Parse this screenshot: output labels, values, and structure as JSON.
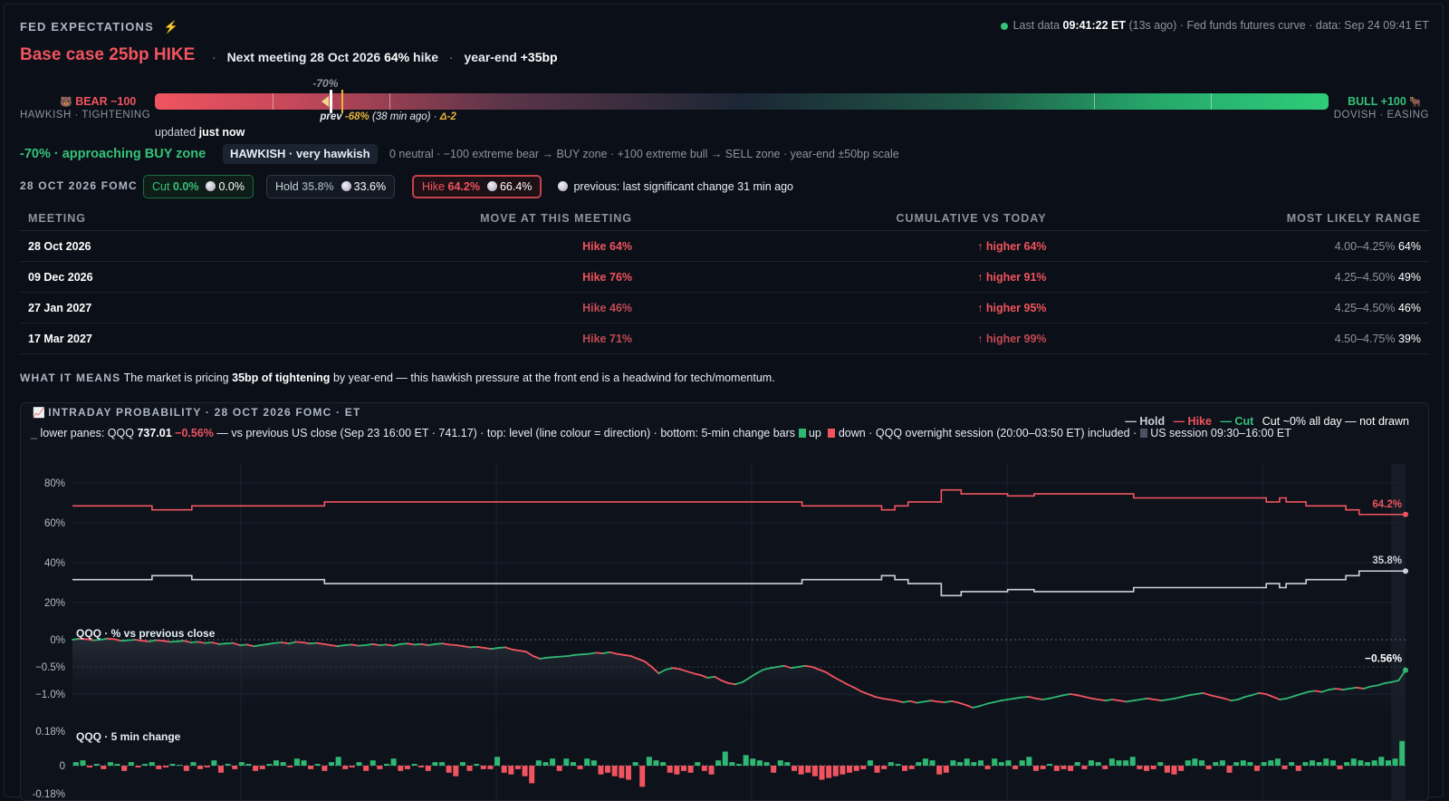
{
  "header": {
    "title": "FED EXPECTATIONS",
    "title_icon": "lightning-icon",
    "status_prefix": "Last data",
    "status_time": "09:41:22 ET",
    "status_ago": "(13s ago)",
    "status_sep": "·",
    "status_source": "Fed funds futures curve",
    "status_data": "data: Sep 24 09:41 ET"
  },
  "headline": {
    "base_case": "Base case 25bp HIKE",
    "sep": "·",
    "next_prefix": "Next meeting 28 Oct 2026",
    "next_pct": "64%",
    "next_suffix": "hike",
    "ye_prefix": "year-end",
    "ye_value": "+35bp"
  },
  "gauge": {
    "bear_label": "BEAR −100",
    "bear_sub": "HAWKISH · TIGHTENING",
    "bull_label": "BULL +100",
    "bull_sub": "DOVISH · EASING",
    "current_label": "-70%",
    "current_value": -70,
    "prev_label": "prev",
    "prev_value_label": "-68%",
    "prev_value": -68,
    "prev_ago": "(38 min ago)",
    "delta": "Δ-2",
    "updated_prefix": "updated",
    "updated_value": "just now"
  },
  "zone": {
    "value": "-70% · approaching BUY zone",
    "badge": "HAWKISH · very hawkish",
    "scale_note": "0 neutral · −100 extreme bear → BUY zone · +100 extreme bull → SELL zone · year-end ±50bp scale"
  },
  "fomc": {
    "label": "28 OCT 2026 FOMC",
    "pills": [
      {
        "name": "Cut",
        "pct": "0.0%",
        "prev": "0.0%",
        "color": "#35c27a"
      },
      {
        "name": "Hold",
        "pct": "35.8%",
        "prev": "33.6%",
        "color": "#8b949e"
      },
      {
        "name": "Hike",
        "pct": "64.2%",
        "prev": "66.4%",
        "color": "#f0545f"
      }
    ],
    "previous_note": "previous: last significant change 31 min ago"
  },
  "table": {
    "headers": [
      "MEETING",
      "MOVE AT THIS MEETING",
      "CUMULATIVE VS TODAY",
      "MOST LIKELY RANGE"
    ],
    "rows": [
      {
        "meeting": "28 Oct 2026",
        "move": "Hike 64%",
        "cum": "↑ higher 64%",
        "range": "4.00–4.25%",
        "range_pct": "64%"
      },
      {
        "meeting": "09 Dec 2026",
        "move": "Hike 76%",
        "cum": "↑ higher 91%",
        "range": "4.25–4.50%",
        "range_pct": "49%"
      },
      {
        "meeting": "27 Jan 2027",
        "move": "Hike 46%",
        "cum": "↑ higher 95%",
        "range": "4.25–4.50%",
        "range_pct": "46%"
      },
      {
        "meeting": "17 Mar 2027",
        "move": "Hike 71%",
        "cum": "↑ higher 99%",
        "range": "4.50–4.75%",
        "range_pct": "39%"
      }
    ]
  },
  "meaning": {
    "label": "WHAT IT MEANS",
    "text1": "The market is pricing",
    "bold": "35bp of tightening",
    "text2": "by year-end — this hawkish pressure at the front end is a headwind for tech/momentum."
  },
  "intraday": {
    "title": "INTRADAY PROBABILITY · 28 OCT 2026 FOMC · ET",
    "title_icon": "chart-icon",
    "legend_hold": "— Hold",
    "legend_hike": "— Hike",
    "legend_cut": "— Cut",
    "legend_note": "Cut ~0% all day — not drawn",
    "sub_prefix": "lower panes: QQQ",
    "qqq_price": "737.01",
    "qqq_change": "−0.56%",
    "sub_mid": "— vs previous US close (Sep 23 16:00 ET · 741.17) · top: level (line colour = direction) · bottom: 5-min change bars",
    "up_label": "up",
    "down_label": "down",
    "sub_tail": "· QQQ overnight session (20:00–03:50 ET) included ·",
    "us_session": "US session 09:30–16:00 ET",
    "pane2_label": "QQQ · % vs previous close",
    "pane3_label": "QQQ · 5 min change"
  },
  "chart_data": [
    {
      "type": "line",
      "title": "INTRADAY PROBABILITY · 28 OCT 2026 FOMC · ET",
      "ylim": [
        10,
        85
      ],
      "yticks": [
        "80%",
        "60%",
        "40%",
        "20%"
      ],
      "series": [
        {
          "name": "Hike",
          "color": "#f0545f",
          "end_label": "64.2%",
          "values": [
            68.5,
            68.5,
            68.5,
            68.5,
            68.5,
            68.5,
            68.5,
            68.5,
            68.5,
            68.5,
            68.5,
            68.5,
            66.5,
            66.5,
            66.5,
            66.5,
            66.5,
            66.5,
            68.5,
            68.5,
            68.5,
            68.5,
            68.5,
            68.5,
            68.5,
            68.5,
            68.5,
            68.5,
            68.5,
            68.5,
            68.5,
            68.5,
            68.5,
            68.5,
            68.5,
            68.5,
            68.5,
            68.5,
            70.5,
            70.5,
            70.5,
            70.5,
            70.5,
            70.5,
            70.5,
            70.5,
            70.5,
            70.5,
            70.5,
            70.5,
            70.5,
            70.5,
            70.5,
            70.5,
            70.5,
            70.5,
            70.5,
            70.5,
            70.5,
            70.5,
            70.5,
            70.5,
            70.5,
            70.5,
            70.5,
            70.5,
            70.5,
            70.5,
            70.5,
            70.5,
            70.5,
            70.5,
            70.5,
            70.5,
            70.5,
            70.5,
            70.5,
            70.5,
            70.5,
            70.5,
            70.5,
            70.5,
            70.5,
            70.5,
            70.5,
            70.5,
            70.5,
            70.5,
            70.5,
            70.5,
            70.5,
            70.5,
            70.5,
            70.5,
            70.5,
            70.5,
            70.5,
            70.5,
            70.5,
            70.5,
            70.5,
            70.5,
            70.5,
            70.5,
            70.5,
            70.5,
            70.5,
            70.5,
            70.5,
            70.5,
            68.5,
            68.5,
            68.5,
            68.5,
            68.5,
            68.5,
            68.5,
            68.5,
            68.5,
            68.5,
            68.5,
            68.5,
            66.5,
            66.5,
            68.5,
            68.5,
            70.5,
            70.5,
            70.5,
            70.5,
            70.5,
            76.5,
            76.5,
            76.5,
            74.5,
            74.5,
            74.5,
            74.5,
            74.5,
            74.5,
            74.5,
            73.5,
            73.5,
            73.5,
            73.5,
            74.5,
            74.5,
            74.5,
            74.5,
            74.5,
            74.5,
            74.5,
            74.5,
            74.5,
            74.5,
            74.5,
            74.5,
            74.5,
            74.5,
            74.5,
            72.5,
            72.5,
            72.5,
            72.5,
            72.5,
            72.5,
            72.5,
            72.5,
            72.5,
            72.5,
            72.5,
            72.5,
            72.5,
            72.5,
            72.5,
            72.5,
            72.5,
            72.5,
            72.5,
            72.5,
            70.5,
            70.5,
            72.5,
            70.5,
            70.5,
            70.5,
            68.5,
            68.5,
            68.5,
            68.5,
            68.5,
            68.5,
            66.5,
            66.5,
            64.2,
            64.2,
            64.2,
            64.2,
            64.2,
            64.2,
            64.2,
            64.2
          ]
        },
        {
          "name": "Hold",
          "color": "#c9d1d9",
          "end_label": "35.8%",
          "values": [
            31.5,
            31.5,
            31.5,
            31.5,
            31.5,
            31.5,
            31.5,
            31.5,
            31.5,
            31.5,
            31.5,
            31.5,
            33.5,
            33.5,
            33.5,
            33.5,
            33.5,
            33.5,
            31.5,
            31.5,
            31.5,
            31.5,
            31.5,
            31.5,
            31.5,
            31.5,
            31.5,
            31.5,
            31.5,
            31.5,
            31.5,
            31.5,
            31.5,
            31.5,
            31.5,
            31.5,
            31.5,
            31.5,
            29.5,
            29.5,
            29.5,
            29.5,
            29.5,
            29.5,
            29.5,
            29.5,
            29.5,
            29.5,
            29.5,
            29.5,
            29.5,
            29.5,
            29.5,
            29.5,
            29.5,
            29.5,
            29.5,
            29.5,
            29.5,
            29.5,
            29.5,
            29.5,
            29.5,
            29.5,
            29.5,
            29.5,
            29.5,
            29.5,
            29.5,
            29.5,
            29.5,
            29.5,
            29.5,
            29.5,
            29.5,
            29.5,
            29.5,
            29.5,
            29.5,
            29.5,
            29.5,
            29.5,
            29.5,
            29.5,
            29.5,
            29.5,
            29.5,
            29.5,
            29.5,
            29.5,
            29.5,
            29.5,
            29.5,
            29.5,
            29.5,
            29.5,
            29.5,
            29.5,
            29.5,
            29.5,
            29.5,
            29.5,
            29.5,
            29.5,
            29.5,
            29.5,
            29.5,
            29.5,
            29.5,
            29.5,
            31.5,
            31.5,
            31.5,
            31.5,
            31.5,
            31.5,
            31.5,
            31.5,
            31.5,
            31.5,
            31.5,
            31.5,
            33.5,
            33.5,
            31.5,
            31.5,
            29.5,
            29.5,
            29.5,
            29.5,
            29.5,
            23.5,
            23.5,
            23.5,
            25.5,
            25.5,
            25.5,
            25.5,
            25.5,
            25.5,
            25.5,
            26.5,
            26.5,
            26.5,
            26.5,
            25.5,
            25.5,
            25.5,
            25.5,
            25.5,
            25.5,
            25.5,
            25.5,
            25.5,
            25.5,
            25.5,
            25.5,
            25.5,
            25.5,
            25.5,
            27.5,
            27.5,
            27.5,
            27.5,
            27.5,
            27.5,
            27.5,
            27.5,
            27.5,
            27.5,
            27.5,
            27.5,
            27.5,
            27.5,
            27.5,
            27.5,
            27.5,
            27.5,
            27.5,
            27.5,
            29.5,
            29.5,
            27.5,
            29.5,
            29.5,
            29.5,
            31.5,
            31.5,
            31.5,
            31.5,
            31.5,
            31.5,
            33.5,
            33.5,
            35.8,
            35.8,
            35.8,
            35.8,
            35.8,
            35.8,
            35.8,
            35.8
          ]
        }
      ]
    },
    {
      "type": "line",
      "title": "QQQ · % vs previous close",
      "ylim": [
        -1.35,
        0.1
      ],
      "yticks": [
        "0%",
        "−0.5%",
        "−1.0%"
      ],
      "end_label": "−0.56%",
      "series": [
        {
          "name": "QQQ",
          "values": [
            0.0,
            0.02,
            0.01,
            -0.01,
            0.0,
            0.02,
            0.01,
            -0.02,
            -0.01,
            0.0,
            -0.02,
            -0.03,
            -0.01,
            -0.02,
            -0.04,
            -0.03,
            -0.02,
            -0.05,
            -0.04,
            -0.06,
            -0.05,
            -0.08,
            -0.07,
            -0.06,
            -0.1,
            -0.09,
            -0.12,
            -0.1,
            -0.08,
            -0.06,
            -0.05,
            -0.07,
            -0.04,
            -0.05,
            -0.07,
            -0.06,
            -0.08,
            -0.1,
            -0.12,
            -0.1,
            -0.09,
            -0.11,
            -0.1,
            -0.08,
            -0.1,
            -0.09,
            -0.11,
            -0.08,
            -0.07,
            -0.09,
            -0.08,
            -0.1,
            -0.08,
            -0.07,
            -0.09,
            -0.1,
            -0.12,
            -0.14,
            -0.13,
            -0.15,
            -0.17,
            -0.15,
            -0.14,
            -0.18,
            -0.2,
            -0.22,
            -0.3,
            -0.35,
            -0.33,
            -0.32,
            -0.31,
            -0.3,
            -0.28,
            -0.27,
            -0.26,
            -0.24,
            -0.25,
            -0.23,
            -0.26,
            -0.28,
            -0.3,
            -0.35,
            -0.4,
            -0.5,
            -0.62,
            -0.55,
            -0.52,
            -0.54,
            -0.58,
            -0.62,
            -0.65,
            -0.7,
            -0.68,
            -0.75,
            -0.8,
            -0.82,
            -0.78,
            -0.7,
            -0.62,
            -0.55,
            -0.52,
            -0.5,
            -0.48,
            -0.52,
            -0.5,
            -0.48,
            -0.5,
            -0.55,
            -0.6,
            -0.68,
            -0.75,
            -0.82,
            -0.88,
            -0.95,
            -1.0,
            -1.05,
            -1.08,
            -1.1,
            -1.12,
            -1.15,
            -1.13,
            -1.16,
            -1.14,
            -1.12,
            -1.14,
            -1.15,
            -1.13,
            -1.16,
            -1.2,
            -1.25,
            -1.22,
            -1.18,
            -1.15,
            -1.12,
            -1.1,
            -1.08,
            -1.06,
            -1.05,
            -1.08,
            -1.1,
            -1.08,
            -1.05,
            -1.02,
            -1.0,
            -1.02,
            -1.05,
            -1.08,
            -1.1,
            -1.12,
            -1.1,
            -1.12,
            -1.14,
            -1.12,
            -1.1,
            -1.08,
            -1.1,
            -1.12,
            -1.1,
            -1.08,
            -1.05,
            -1.02,
            -1.0,
            -0.98,
            -1.02,
            -1.05,
            -1.08,
            -1.12,
            -1.1,
            -1.05,
            -1.02,
            -0.98,
            -1.0,
            -1.05,
            -1.1,
            -1.08,
            -1.04,
            -1.0,
            -0.96,
            -0.94,
            -0.96,
            -0.92,
            -0.9,
            -0.92,
            -0.9,
            -0.88,
            -0.9,
            -0.86,
            -0.84,
            -0.8,
            -0.78,
            -0.75,
            -0.56
          ]
        }
      ]
    },
    {
      "type": "bar",
      "title": "QQQ · 5 min change",
      "ylim": [
        -0.18,
        0.18
      ],
      "yticks": [
        "0.18%",
        "0",
        "-0.18%"
      ],
      "values": [
        0.02,
        0.03,
        -0.01,
        0.01,
        -0.02,
        0.02,
        0.01,
        -0.03,
        0.02,
        -0.01,
        0.01,
        0.02,
        -0.02,
        -0.01,
        0.01,
        0.0,
        -0.03,
        0.02,
        -0.02,
        -0.01,
        0.03,
        -0.04,
        0.01,
        -0.02,
        0.02,
        0.01,
        -0.03,
        -0.02,
        0.01,
        0.03,
        0.02,
        -0.01,
        0.04,
        0.03,
        -0.02,
        0.01,
        -0.03,
        0.02,
        0.05,
        -0.02,
        -0.01,
        0.02,
        -0.03,
        0.03,
        -0.02,
        0.01,
        0.04,
        -0.03,
        -0.02,
        0.01,
        -0.01,
        -0.03,
        0.02,
        0.02,
        -0.04,
        -0.06,
        0.02,
        -0.03,
        0.01,
        -0.02,
        -0.02,
        0.05,
        -0.04,
        -0.05,
        -0.02,
        -0.06,
        -0.1,
        0.03,
        0.02,
        0.04,
        -0.03,
        0.04,
        0.02,
        -0.02,
        0.04,
        0.03,
        -0.05,
        -0.04,
        -0.06,
        -0.07,
        -0.08,
        0.02,
        -0.12,
        0.05,
        0.03,
        0.02,
        -0.04,
        -0.05,
        -0.03,
        -0.04,
        0.02,
        -0.03,
        -0.05,
        0.03,
        0.08,
        0.02,
        0.01,
        0.06,
        0.04,
        0.03,
        0.02,
        -0.04,
        0.03,
        0.02,
        -0.03,
        -0.05,
        -0.04,
        -0.06,
        -0.08,
        -0.07,
        -0.06,
        -0.05,
        -0.04,
        -0.03,
        -0.02,
        0.03,
        -0.04,
        -0.02,
        0.02,
        0.01,
        -0.03,
        -0.02,
        0.02,
        0.04,
        0.03,
        -0.05,
        -0.04,
        0.03,
        0.02,
        0.04,
        0.02,
        0.03,
        -0.02,
        0.04,
        0.02,
        0.03,
        -0.02,
        0.03,
        0.05,
        -0.03,
        -0.02,
        0.01,
        -0.03,
        -0.02,
        -0.03,
        0.02,
        -0.02,
        0.03,
        0.02,
        -0.02,
        0.04,
        0.03,
        0.03,
        0.05,
        -0.02,
        -0.03,
        -0.02,
        0.02,
        -0.04,
        -0.05,
        -0.03,
        0.03,
        0.04,
        0.03,
        -0.02,
        0.02,
        0.03,
        -0.04,
        0.02,
        0.03,
        0.02,
        -0.03,
        0.02,
        0.03,
        0.04,
        -0.02,
        0.02,
        -0.03,
        0.02,
        0.03,
        0.02,
        0.04,
        0.03,
        -0.02,
        0.02,
        0.04,
        0.03,
        0.02,
        0.03,
        0.05,
        0.03,
        0.04,
        0.14
      ]
    }
  ],
  "colors": {
    "background": "#0b0f17",
    "hawkish_red": "#f0545f",
    "dovish_green": "#35c27a",
    "hold_grey": "#c9d1d9",
    "prev_amber": "#e8b339"
  }
}
